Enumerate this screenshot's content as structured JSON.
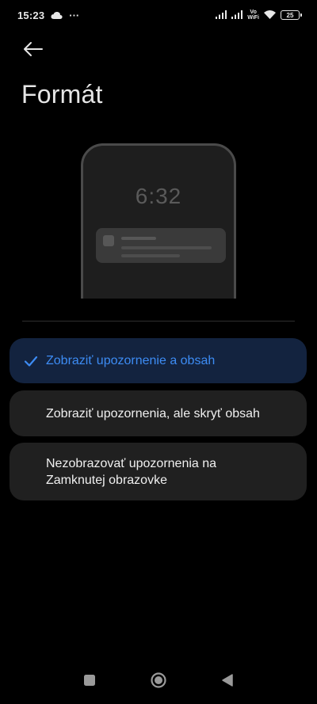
{
  "status_bar": {
    "time": "15:23",
    "more": "···",
    "vowifi_top": "Vo",
    "vowifi_bottom": "WiFi",
    "battery": "25"
  },
  "header": {
    "title": "Formát"
  },
  "preview": {
    "clock": "6:32"
  },
  "options": [
    {
      "label": "Zobraziť upozornenie a obsah",
      "selected": true
    },
    {
      "label": "Zobraziť upozornenia, ale skryť obsah",
      "selected": false
    },
    {
      "label": "Nezobrazovať upozornenia na Zamknutej obrazovke",
      "selected": false
    }
  ],
  "colors": {
    "background": "#000000",
    "option_bg": "#202020",
    "selected_bg": "#13233f",
    "accent": "#3d8cf4"
  },
  "icons": {
    "back": "arrow-left-icon",
    "check": "checkmark-icon",
    "nav_recents": "square-icon",
    "nav_home": "circle-icon",
    "nav_back": "triangle-icon"
  }
}
